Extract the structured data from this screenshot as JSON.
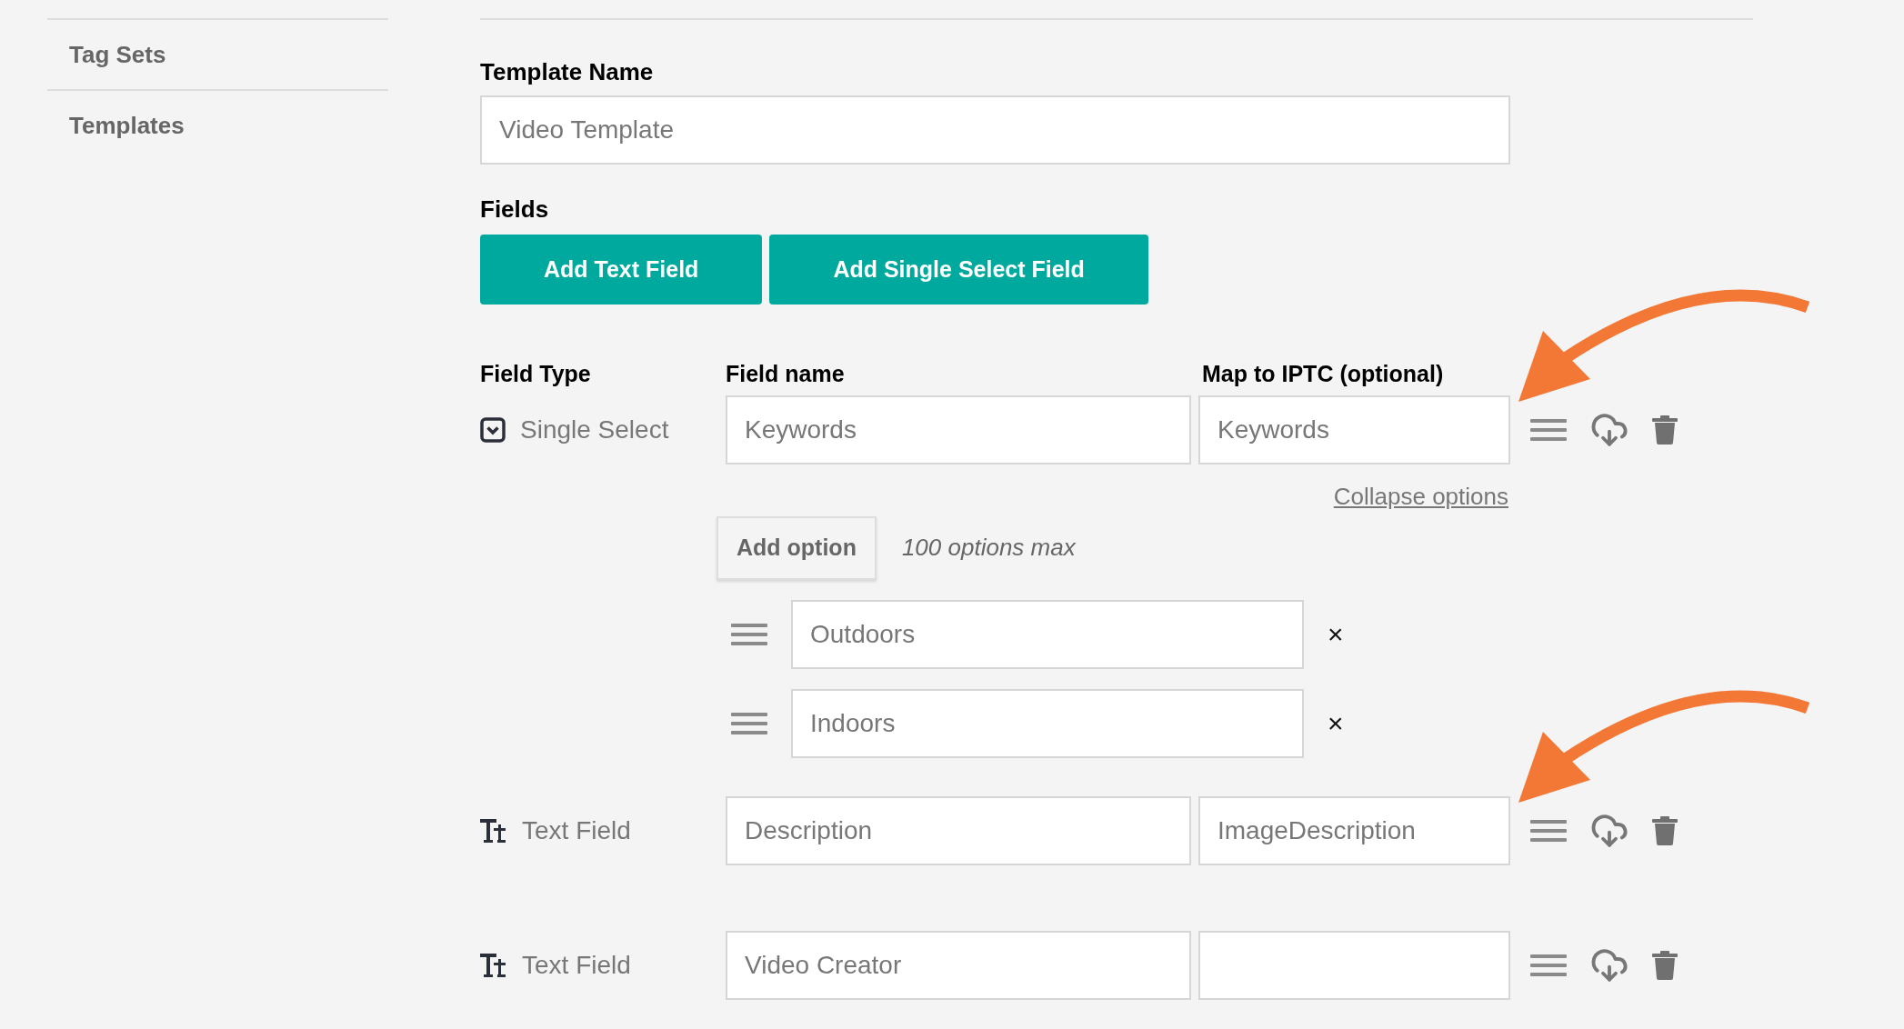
{
  "sidebar": {
    "items": [
      "Tag Sets",
      "Templates"
    ]
  },
  "template_name": {
    "label": "Template Name",
    "value": "Video Template"
  },
  "fields_section": {
    "label": "Fields",
    "buttons": [
      "Add Text Field",
      "Add Single Select Field"
    ]
  },
  "columns": [
    "Field Type",
    "Field name",
    "Map to IPTC (optional)"
  ],
  "fields": [
    {
      "kind": "select",
      "type_label": "Single Select",
      "name": "Keywords",
      "iptc": "Keywords",
      "callout": true,
      "options_link": "Collapse options",
      "add_option": "Add option",
      "options_note": "100 options max",
      "options": [
        {
          "value": "Outdoors",
          "remove": "×"
        },
        {
          "value": "Indoors",
          "remove": "×"
        }
      ]
    },
    {
      "kind": "text",
      "type_label": "Text Field",
      "name": "Description",
      "iptc": "ImageDescription",
      "callout": true
    },
    {
      "kind": "text",
      "type_label": "Text Field",
      "name": "Video Creator",
      "callout": false
    }
  ]
}
